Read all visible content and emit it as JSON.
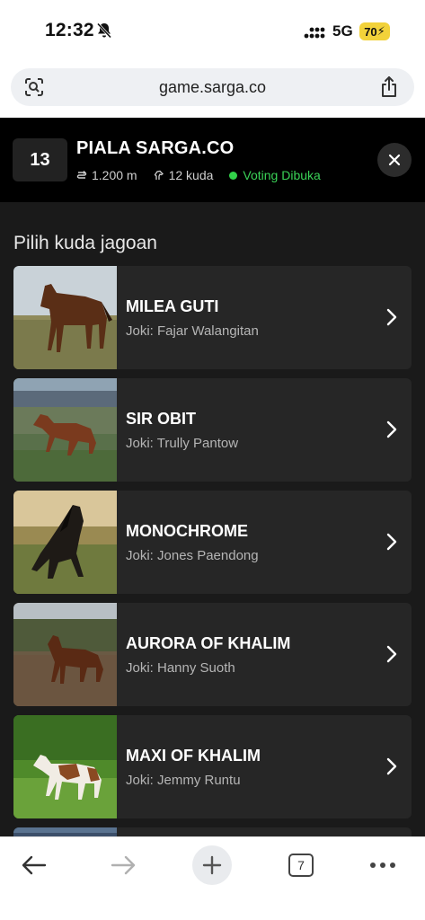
{
  "status_bar": {
    "time": "12:32",
    "network": "5G",
    "battery": "70"
  },
  "browser": {
    "url": "game.sarga.co",
    "tab_count": "7"
  },
  "race": {
    "number": "13",
    "title": "PIALA SARGA.CO",
    "distance": "1.200 m",
    "horses": "12 kuda",
    "status": "Voting Dibuka",
    "status_color": "#3ad257"
  },
  "section_title": "Pilih kuda jagoan",
  "horses": [
    {
      "name": "MILEA GUTI",
      "jockey": "Joki: Fajar Walangitan"
    },
    {
      "name": "SIR OBIT",
      "jockey": "Joki: Trully Pantow"
    },
    {
      "name": "MONOCHROME",
      "jockey": "Joki: Jones Paendong"
    },
    {
      "name": "AURORA OF KHALIM",
      "jockey": "Joki: Hanny Suoth"
    },
    {
      "name": "MAXI OF KHALIM",
      "jockey": "Joki: Jemmy Runtu"
    }
  ],
  "icons": {
    "mute": "bell-slash-icon",
    "signal": "cellular-signal-icon",
    "lens": "camera-search-icon",
    "share": "share-icon",
    "distance": "route-icon",
    "horse": "horse-icon",
    "close": "close-icon",
    "chevron": "chevron-right-icon",
    "back": "arrow-left-icon",
    "forward": "arrow-right-icon",
    "new_tab": "plus-icon",
    "tabs": "tabs-icon",
    "more": "more-horizontal-icon"
  }
}
